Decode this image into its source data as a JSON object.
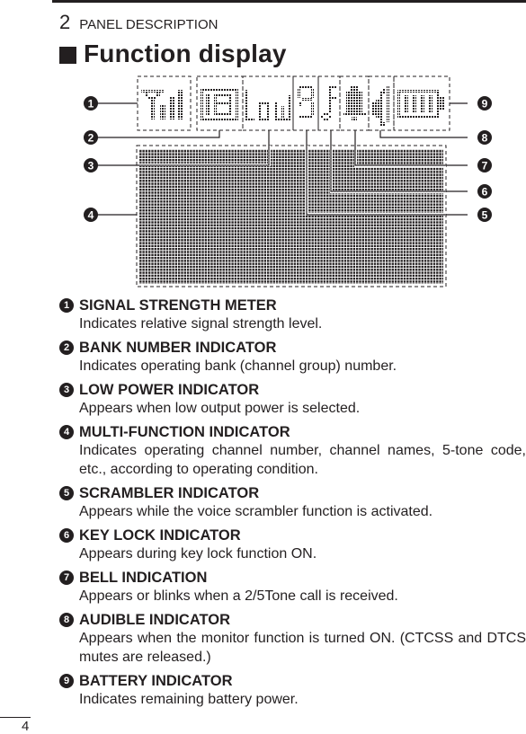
{
  "header": {
    "chapter_number": "2",
    "chapter_title": "PANEL DESCRIPTION",
    "section_title": "Function display"
  },
  "diagram": {
    "callout_numbers": [
      "1",
      "2",
      "3",
      "4",
      "5",
      "6",
      "7",
      "8",
      "9"
    ],
    "segments": {
      "signal": "signal-strength-meter-icon",
      "bank": "bank-number-icon",
      "low": "low-power-icon",
      "scrambler": "scrambler-icon",
      "lock": "key-lock-icon",
      "bell": "bell-icon",
      "audible": "speaker-icon",
      "battery": "battery-icon"
    }
  },
  "items": [
    {
      "num": "1",
      "title": "SIGNAL STRENGTH METER",
      "desc": "Indicates relative signal strength level."
    },
    {
      "num": "2",
      "title": "BANK NUMBER INDICATOR",
      "desc": "Indicates operating bank (channel group) number."
    },
    {
      "num": "3",
      "title": "LOW POWER INDICATOR",
      "desc": "Appears when low output power is selected."
    },
    {
      "num": "4",
      "title": "MULTI-FUNCTION INDICATOR",
      "desc": "Indicates operating channel number, channel names, 5-tone code, etc., according to operating condition."
    },
    {
      "num": "5",
      "title": "SCRAMBLER INDICATOR",
      "desc": "Appears while the voice scrambler function is activated."
    },
    {
      "num": "6",
      "title": "KEY LOCK INDICATOR",
      "desc": "Appears during key lock function ON."
    },
    {
      "num": "7",
      "title": "BELL INDICATION",
      "desc": "Appears or blinks when a 2/5Tone call is received."
    },
    {
      "num": "8",
      "title": "AUDIBLE INDICATOR",
      "desc": "Appears when the monitor function is turned ON. (CTCSS and DTCS mutes are released.)"
    },
    {
      "num": "9",
      "title": "BATTERY INDICATOR",
      "desc": "Indicates remaining battery power."
    }
  ],
  "footer": {
    "page_number": "4"
  }
}
